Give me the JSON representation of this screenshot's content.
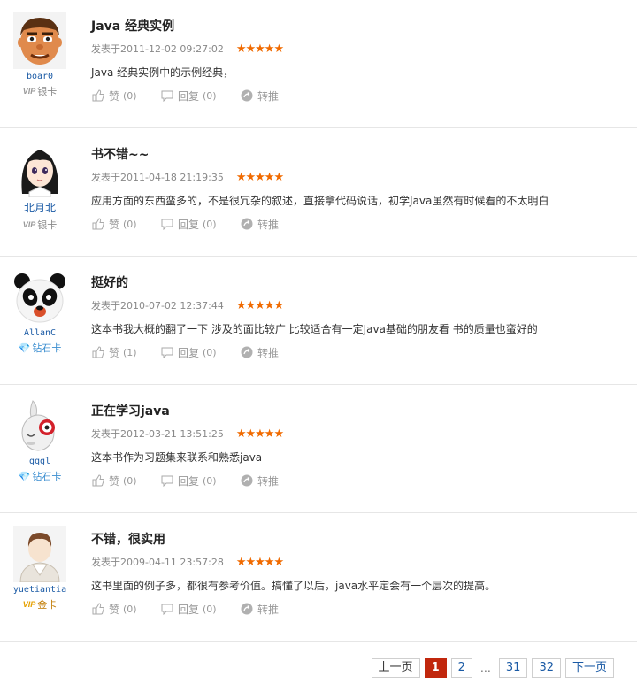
{
  "reviews": [
    {
      "username": "boar0",
      "level": "银卡",
      "vip": "VIP",
      "title": "Java 经典实例",
      "date": "发表于2011-12-02 09:27:02",
      "stars": "★★★★★",
      "text": "Java 经典实例中的示例经典，",
      "like_label": "赞",
      "like_count": "(0)",
      "reply_label": "回复",
      "reply_count": "(0)",
      "share_label": "转推"
    },
    {
      "username": "北月北",
      "level": "银卡",
      "vip": "VIP",
      "title": "书不错~~",
      "date": "发表于2011-04-18 21:19:35",
      "stars": "★★★★★",
      "text": "应用方面的东西蛮多的，不是很冗杂的叙述，直接拿代码说话，初学Java虽然有时候看的不太明白",
      "like_label": "赞",
      "like_count": "(0)",
      "reply_label": "回复",
      "reply_count": "(0)",
      "share_label": "转推"
    },
    {
      "username": "AllanC",
      "level": "钻石卡",
      "vip": "",
      "title": "挺好的",
      "date": "发表于2010-07-02 12:37:44",
      "stars": "★★★★★",
      "text": "这本书我大概的翻了一下 涉及的面比较广 比较适合有一定Java基础的朋友看 书的质量也蛮好的",
      "like_label": "赞",
      "like_count": "(1)",
      "reply_label": "回复",
      "reply_count": "(0)",
      "share_label": "转推"
    },
    {
      "username": "gqgl",
      "level": "钻石卡",
      "vip": "",
      "title": "正在学习java",
      "date": "发表于2012-03-21 13:51:25",
      "stars": "★★★★★",
      "text": "这本书作为习题集来联系和熟悉java",
      "like_label": "赞",
      "like_count": "(0)",
      "reply_label": "回复",
      "reply_count": "(0)",
      "share_label": "转推"
    },
    {
      "username": "yuetiantia",
      "level": "金卡",
      "vip": "VIP",
      "title": "不错，很实用",
      "date": "发表于2009-04-11 23:57:28",
      "stars": "★★★★★",
      "text": "这书里面的例子多，都很有参考价值。搞懂了以后，java水平定会有一个层次的提高。",
      "like_label": "赞",
      "like_count": "(0)",
      "reply_label": "回复",
      "reply_count": "(0)",
      "share_label": "转推"
    }
  ],
  "pagination": {
    "prev": "上一页",
    "pages": [
      "1",
      "2",
      "31",
      "32"
    ],
    "ellipsis": "…",
    "next": "下一页",
    "current": "1"
  },
  "colors": {
    "star": "#f06a00",
    "current_page": "#c1270d",
    "username": "#1a5aa5"
  }
}
